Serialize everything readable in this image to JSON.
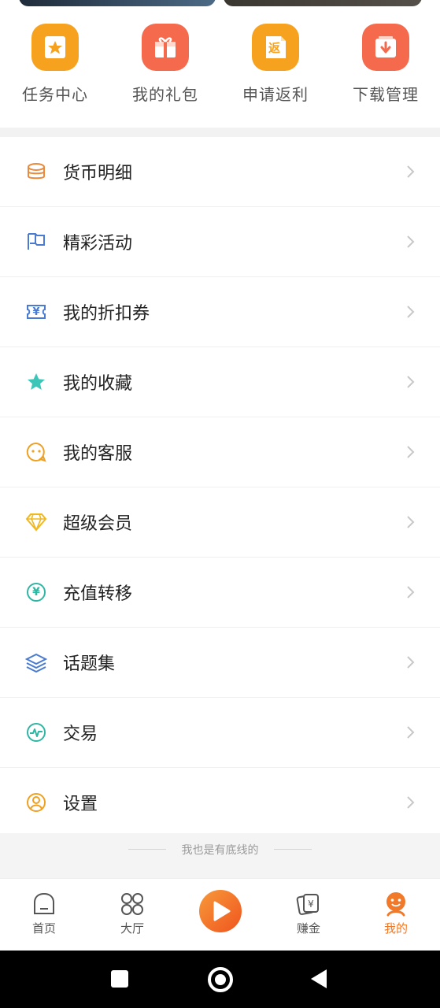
{
  "quick_actions": [
    {
      "label": "任务中心",
      "icon": "task-star-icon",
      "color": "#f7a21e"
    },
    {
      "label": "我的礼包",
      "icon": "gift-icon",
      "color": "#f56a4c"
    },
    {
      "label": "申请返利",
      "icon": "rebate-icon",
      "color": "#f7a21e",
      "glyph": "返"
    },
    {
      "label": "下载管理",
      "icon": "download-icon",
      "color": "#f56a4c"
    }
  ],
  "menu": [
    {
      "label": "货币明细",
      "icon": "coins-icon",
      "color": "#e98a3c"
    },
    {
      "label": "精彩活动",
      "icon": "flag-icon",
      "color": "#4a7bd0"
    },
    {
      "label": "我的折扣券",
      "icon": "coupon-icon",
      "color": "#4a7bd0",
      "glyph": "¥"
    },
    {
      "label": "我的收藏",
      "icon": "star-icon",
      "color": "#3cc6b8"
    },
    {
      "label": "我的客服",
      "icon": "chat-icon",
      "color": "#f0a020"
    },
    {
      "label": "超级会员",
      "icon": "diamond-icon",
      "color": "#f0b820"
    },
    {
      "label": "充值转移",
      "icon": "yuan-circle-icon",
      "color": "#2fb6a3",
      "glyph": "¥"
    },
    {
      "label": "话题集",
      "icon": "layers-icon",
      "color": "#4a7bd0"
    },
    {
      "label": "交易",
      "icon": "pulse-icon",
      "color": "#2fb6a3"
    },
    {
      "label": "设置",
      "icon": "user-circle-icon",
      "color": "#f0a020"
    }
  ],
  "footer_text": "我也是有底线的",
  "tabs": [
    {
      "label": "首页",
      "icon": "home-icon"
    },
    {
      "label": "大厅",
      "icon": "grid-icon"
    },
    {
      "label": "",
      "icon": "play-icon"
    },
    {
      "label": "赚金",
      "icon": "money-cards-icon"
    },
    {
      "label": "我的",
      "icon": "profile-icon",
      "active": true
    }
  ],
  "colors": {
    "accent": "#f07a2a"
  }
}
